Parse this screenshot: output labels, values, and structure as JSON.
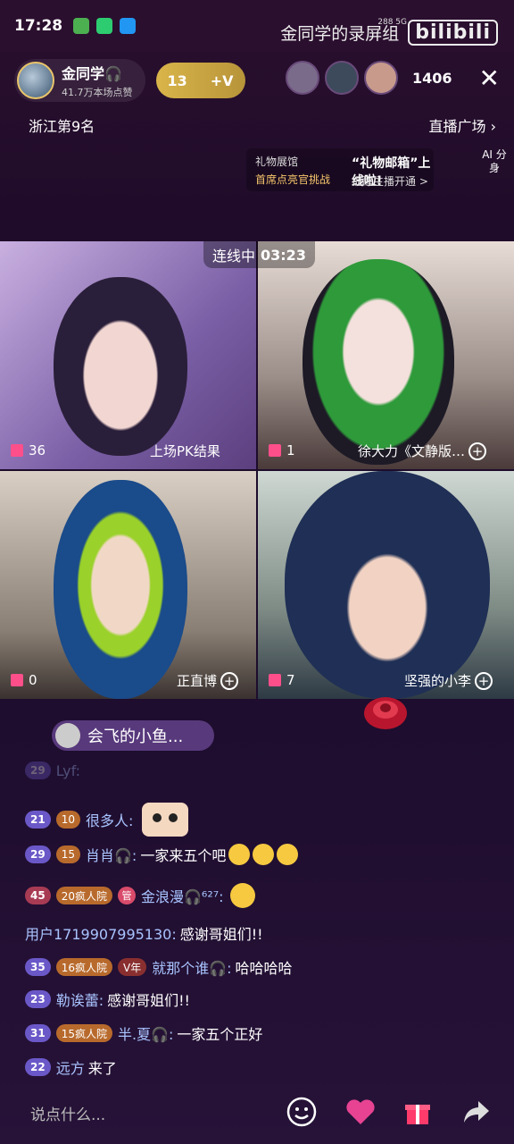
{
  "status": {
    "time": "17:28",
    "net": "288 5G"
  },
  "watermark": {
    "text": "金同学的录屏组",
    "logo": "bilibili"
  },
  "host": {
    "name": "金同学🎧",
    "sub": "41.7万本场点赞",
    "level_badge": "13",
    "v_badge": "+V"
  },
  "viewers": {
    "count": "1406"
  },
  "rank": {
    "label": "浙江第9名",
    "plaza": "直播广场"
  },
  "promo": {
    "left_top": "礼物展馆",
    "left_bottom": "首席点亮官挑战",
    "right_top": "“礼物邮箱”上线啦!",
    "right_bottom": "提醒主播开通 >",
    "ai": "AI 分身"
  },
  "linkmic": {
    "label": "连线中",
    "timer": "03:23"
  },
  "tiles": [
    {
      "score": "36",
      "label": "上场PK结果"
    },
    {
      "score": "1",
      "label": "徐大力《文静版…"
    },
    {
      "score": "0",
      "label": "正直博"
    },
    {
      "score": "7",
      "label": "坚强的小李"
    }
  ],
  "sender_pill": {
    "name": "会飞的小鱼..."
  },
  "chat": [
    {
      "level": "29",
      "fan": "",
      "user": "Lyf:",
      "text": ""
    },
    {
      "level": "21",
      "fan": "10",
      "user": "很多人:",
      "text": ""
    },
    {
      "level": "29",
      "fan": "15",
      "user": "肖肖🎧:",
      "text": "一家来五个吧"
    },
    {
      "level": "45",
      "fan": "20疯人院",
      "admin": "管",
      "user": "金浪漫🎧⁶²⁷:",
      "text": ""
    },
    {
      "level": "",
      "fan": "",
      "user": "用户1719907995130:",
      "text": "感谢哥姐们!!"
    },
    {
      "level": "35",
      "fan": "16疯人院",
      "vyear": "V年",
      "user": "就那个谁🎧:",
      "text": "哈哈哈哈"
    },
    {
      "level": "23",
      "fan": "",
      "user": "勒诶蕾:",
      "text": "感谢哥姐们!!"
    },
    {
      "level": "31",
      "fan": "15疯人院",
      "user": "半.夏🎧:",
      "text": "一家五个正好"
    },
    {
      "level": "22",
      "fan": "",
      "user": "远方",
      "text": "来了"
    }
  ],
  "bottom": {
    "placeholder": "说点什么..."
  }
}
